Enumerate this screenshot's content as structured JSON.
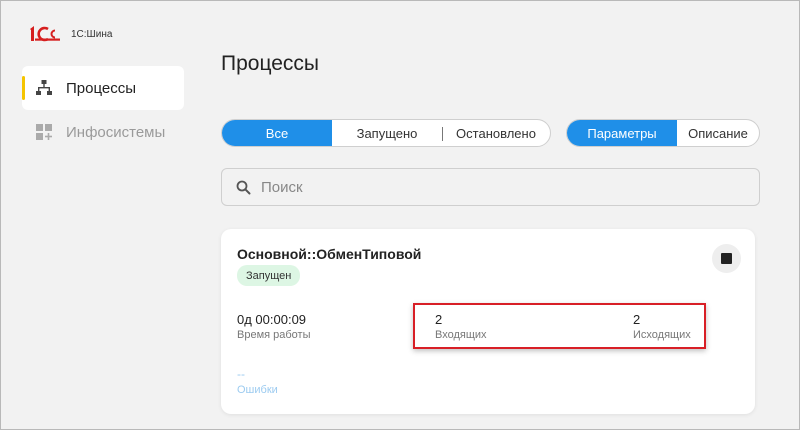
{
  "app": {
    "logo_text": "1С:Шина"
  },
  "sidebar": {
    "items": [
      {
        "label": "Процессы",
        "icon": "hierarchy-icon",
        "active": true
      },
      {
        "label": "Инфосистемы",
        "icon": "apps-add-icon",
        "active": false
      }
    ]
  },
  "page": {
    "title": "Процессы"
  },
  "filters": {
    "status": [
      {
        "label": "Все",
        "active": true
      },
      {
        "label": "Запущено",
        "active": false
      },
      {
        "label": "Остановлено",
        "active": false
      }
    ],
    "view": [
      {
        "label": "Параметры",
        "active": true
      },
      {
        "label": "Описание",
        "active": false
      }
    ]
  },
  "search": {
    "placeholder": "Поиск",
    "value": ""
  },
  "process_card": {
    "name": "Основной::ОбменТиповой",
    "status": "Запущен",
    "uptime": {
      "value": "0д 00:00:09",
      "label": "Время работы"
    },
    "incoming": {
      "value": "2",
      "label": "Входящих"
    },
    "outgoing": {
      "value": "2",
      "label": "Исходящих"
    },
    "errors": {
      "value": "--",
      "label": "Ошибки"
    }
  },
  "colors": {
    "accent": "#1f8fe8",
    "active_marker": "#f5c400",
    "status_bg": "#ddf6e4",
    "highlight_border": "#d81f26",
    "errors_text": "#9ccbf0"
  }
}
